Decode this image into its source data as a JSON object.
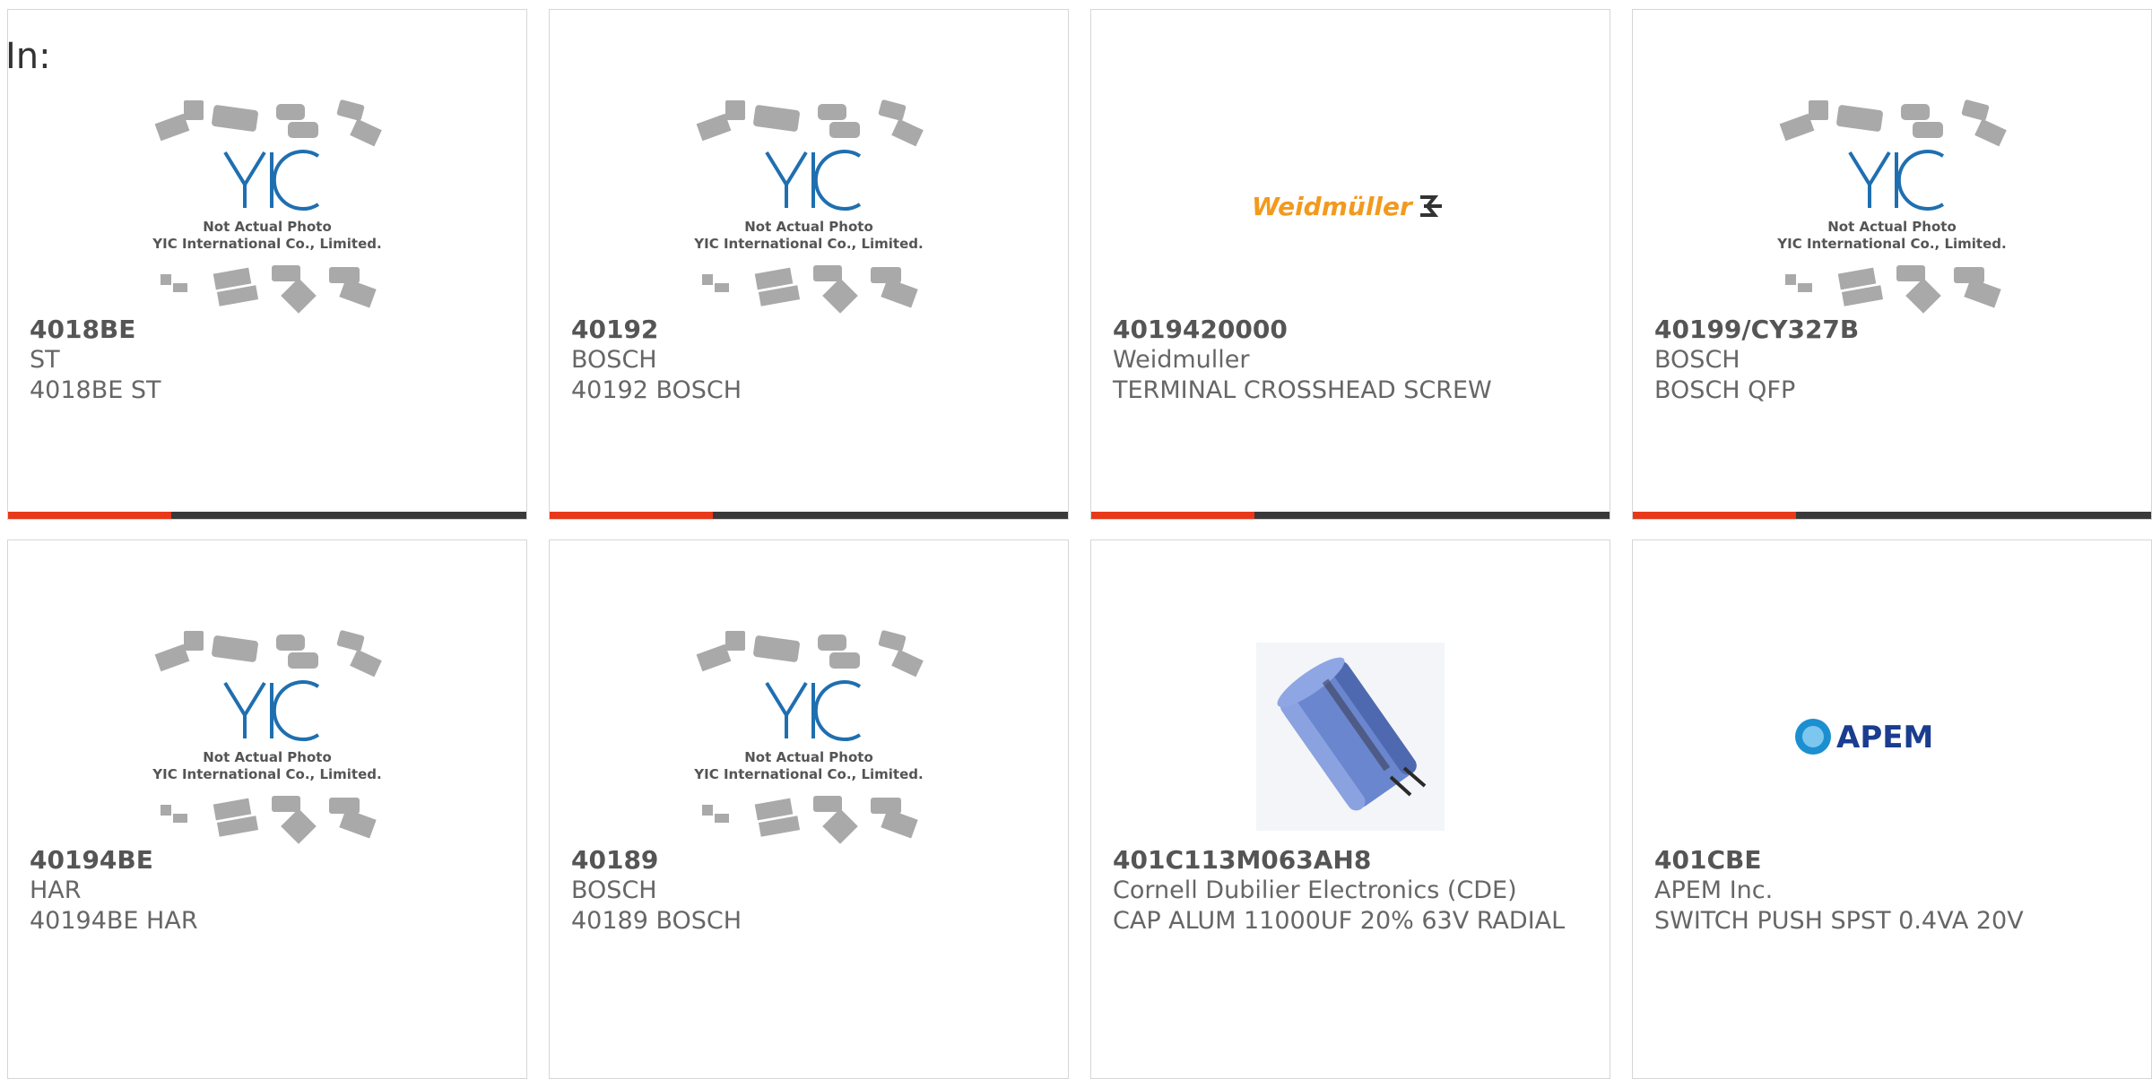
{
  "header": {
    "label": "In:"
  },
  "placeholder": {
    "line1": "Not Actual Photo",
    "line2": "YIC International Co., Limited."
  },
  "logos": {
    "weidmuller": "Weidmüller",
    "apem": "APEM"
  },
  "products": [
    {
      "part": "4018BE",
      "manufacturer": "ST",
      "description": "4018BE ST",
      "image": "yic-placeholder"
    },
    {
      "part": "40192",
      "manufacturer": "BOSCH",
      "description": "40192 BOSCH",
      "image": "yic-placeholder"
    },
    {
      "part": "4019420000",
      "manufacturer": "Weidmuller",
      "description": "TERMINAL CROSSHEAD SCREW",
      "image": "weidmuller-logo"
    },
    {
      "part": "40199/CY327B",
      "manufacturer": "BOSCH",
      "description": "BOSCH QFP",
      "image": "yic-placeholder"
    },
    {
      "part": "40194BE",
      "manufacturer": "HAR",
      "description": "40194BE HAR",
      "image": "yic-placeholder"
    },
    {
      "part": "40189",
      "manufacturer": "BOSCH",
      "description": "40189 BOSCH",
      "image": "yic-placeholder"
    },
    {
      "part": "401C113M063AH8",
      "manufacturer": "Cornell Dubilier Electronics (CDE)",
      "description": "CAP ALUM 11000UF 20% 63V RADIAL",
      "image": "capacitor-photo"
    },
    {
      "part": "401CBE",
      "manufacturer": "APEM Inc.",
      "description": "SWITCH PUSH SPST 0.4VA 20V",
      "image": "apem-logo"
    }
  ],
  "colors": {
    "accent": "#e8391a",
    "bar": "#3a3a3a",
    "yic_blue": "#1f6fb0"
  }
}
